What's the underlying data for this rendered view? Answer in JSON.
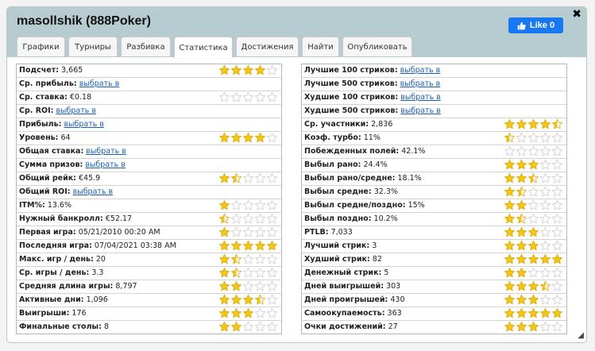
{
  "window": {
    "title": "masollshik (888Poker)",
    "like_label": "Like 0",
    "close_symbol": "✖",
    "resize_symbol": "◢"
  },
  "tabs": [
    {
      "label": "Графики",
      "active": false
    },
    {
      "label": "Турниры",
      "active": false
    },
    {
      "label": "Разбивка",
      "active": false
    },
    {
      "label": "Статистика",
      "active": true
    },
    {
      "label": "Достижения",
      "active": false
    },
    {
      "label": "Найти",
      "active": false
    },
    {
      "label": "Опубликовать",
      "active": false
    }
  ],
  "colors": {
    "star_fill": "#f5c518",
    "star_empty": "#dddddd",
    "link": "#1a5fb4",
    "like_bg": "#1877f2",
    "header_bg": "#b7ccd1"
  },
  "left_stats": [
    {
      "label": "Подсчет:",
      "value": "3,665",
      "link": false,
      "stars": 4
    },
    {
      "label": "Ср. прибыль:",
      "value": "выбрать в",
      "link": true,
      "stars": null
    },
    {
      "label": "Ср. ставка:",
      "value": "€0.18",
      "link": false,
      "stars": 0
    },
    {
      "label": "Ср. ROI:",
      "value": "выбрать в",
      "link": true,
      "stars": null
    },
    {
      "label": "Прибыль:",
      "value": "выбрать в",
      "link": true,
      "stars": null
    },
    {
      "label": "Уровень:",
      "value": "64",
      "link": false,
      "stars": 4
    },
    {
      "label": "Общая ставка:",
      "value": "выбрать в",
      "link": true,
      "stars": null
    },
    {
      "label": "Сумма призов:",
      "value": "выбрать в",
      "link": true,
      "stars": null
    },
    {
      "label": "Общий рейк:",
      "value": "€45.9",
      "link": false,
      "stars": 1.5
    },
    {
      "label": "Общий ROI:",
      "value": "выбрать в",
      "link": true,
      "stars": null
    },
    {
      "label": "ITM%:",
      "value": "13.6%",
      "link": false,
      "stars": 1
    },
    {
      "label": "Нужный банкролл:",
      "value": "€52.17",
      "link": false,
      "stars": 0.5
    },
    {
      "label": "Первая игра:",
      "value": "05/21/2010 00:20 AM",
      "link": false,
      "stars": 1
    },
    {
      "label": "Последняя игра:",
      "value": "07/04/2021 03:38 AM",
      "link": false,
      "stars": 5
    },
    {
      "label": "Макс. игр / день:",
      "value": "20",
      "link": false,
      "stars": 1.5
    },
    {
      "label": "Ср. игры / день:",
      "value": "3.3",
      "link": false,
      "stars": 1.5
    },
    {
      "label": "Средняя длина игры:",
      "value": "8,797",
      "link": false,
      "stars": 2
    },
    {
      "label": "Активные дни:",
      "value": "1,096",
      "link": false,
      "stars": 3.5
    },
    {
      "label": "Выигрыши:",
      "value": "176",
      "link": false,
      "stars": 3
    },
    {
      "label": "Финальные столы:",
      "value": "8",
      "link": false,
      "stars": 2
    }
  ],
  "right_stats": [
    {
      "label": "Лучшие 100 стриков:",
      "value": "выбрать в",
      "link": true,
      "stars": null
    },
    {
      "label": "Лучшие 500 стриков:",
      "value": "выбрать в",
      "link": true,
      "stars": null
    },
    {
      "label": "Худшие 100 стриков:",
      "value": "выбрать в",
      "link": true,
      "stars": null
    },
    {
      "label": "Худшие 500 стриков:",
      "value": "выбрать в",
      "link": true,
      "stars": null
    },
    {
      "label": "Ср. участники:",
      "value": "2,836",
      "link": false,
      "stars": 4.5
    },
    {
      "label": "Коэф. турбо:",
      "value": "11%",
      "link": false,
      "stars": 0.5
    },
    {
      "label": "Побежденных полей:",
      "value": "42.1%",
      "link": false,
      "stars": 0
    },
    {
      "label": "Выбыл рано:",
      "value": "24.4%",
      "link": false,
      "stars": 3
    },
    {
      "label": "Выбыл рано/средне:",
      "value": "18.1%",
      "link": false,
      "stars": 2.5
    },
    {
      "label": "Выбыл средне:",
      "value": "32.3%",
      "link": false,
      "stars": 1.5
    },
    {
      "label": "Выбыл средне/поздно:",
      "value": "15%",
      "link": false,
      "stars": 2
    },
    {
      "label": "Выбыл поздно:",
      "value": "10.2%",
      "link": false,
      "stars": 1.5
    },
    {
      "label": "PTLB:",
      "value": "7,033",
      "link": false,
      "stars": 3
    },
    {
      "label": "Лучший стрик:",
      "value": "3",
      "link": false,
      "stars": 3
    },
    {
      "label": "Худший стрик:",
      "value": "82",
      "link": false,
      "stars": 5
    },
    {
      "label": "Денежный стрик:",
      "value": "5",
      "link": false,
      "stars": 2
    },
    {
      "label": "Дней выигрышей:",
      "value": "303",
      "link": false,
      "stars": 3.5
    },
    {
      "label": "Дней проигрышей:",
      "value": "430",
      "link": false,
      "stars": 3
    },
    {
      "label": "Самоокупаемость:",
      "value": "363",
      "link": false,
      "stars": 5
    },
    {
      "label": "Очки достижений:",
      "value": "27",
      "link": false,
      "stars": 3
    }
  ]
}
